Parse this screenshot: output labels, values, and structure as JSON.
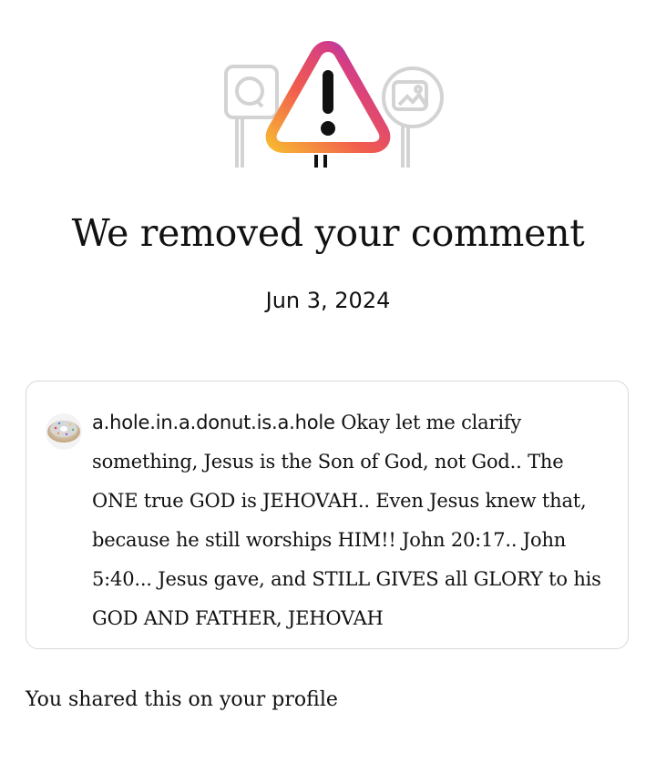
{
  "hero": {
    "icon": "warning-triangle-icon",
    "accent_colors": [
      "#f7b733",
      "#f15c4f",
      "#d43d85",
      "#6a3df0"
    ],
    "outline_color": "#d3d3d3"
  },
  "notice": {
    "title": "We removed your comment",
    "date": "Jun 3, 2024"
  },
  "comment": {
    "avatar_icon": "donut-avatar-icon",
    "username": "a.hole.in.a.donut.is.a.hole",
    "text": "Okay let me clarify something, Jesus is the Son of God, not God.. The ONE true GOD is JEHOVAH.. Even Jesus knew that, because he still worships HIM!! John 20:17.. John 5:40... Jesus gave, and STILL GIVES all GLORY to his GOD AND FATHER, JEHOVAH"
  },
  "footer": {
    "shared_text": "You shared this on your profile"
  }
}
